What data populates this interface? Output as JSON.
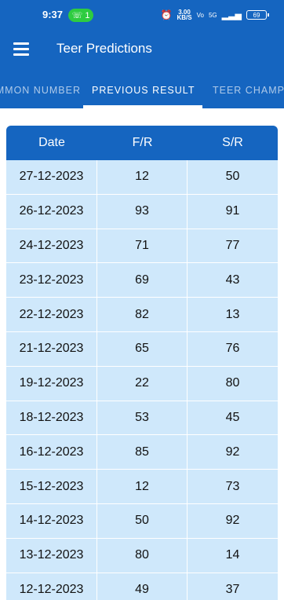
{
  "status_bar": {
    "time": "9:37",
    "call_count": "1",
    "speed_value": "3.00",
    "speed_unit": "KB/S",
    "network": "5G",
    "battery": "69"
  },
  "app_bar": {
    "title": "Teer Predictions"
  },
  "tabs": [
    {
      "label": "COMMON NUMBER"
    },
    {
      "label": "PREVIOUS RESULT"
    },
    {
      "label": "TEER CHAMPION"
    }
  ],
  "table": {
    "headers": [
      "Date",
      "F/R",
      "S/R"
    ],
    "rows": [
      [
        "27-12-2023",
        "12",
        "50"
      ],
      [
        "26-12-2023",
        "93",
        "91"
      ],
      [
        "24-12-2023",
        "71",
        "77"
      ],
      [
        "23-12-2023",
        "69",
        "43"
      ],
      [
        "22-12-2023",
        "82",
        "13"
      ],
      [
        "21-12-2023",
        "65",
        "76"
      ],
      [
        "19-12-2023",
        "22",
        "80"
      ],
      [
        "18-12-2023",
        "53",
        "45"
      ],
      [
        "16-12-2023",
        "85",
        "92"
      ],
      [
        "15-12-2023",
        "12",
        "73"
      ],
      [
        "14-12-2023",
        "50",
        "92"
      ],
      [
        "13-12-2023",
        "80",
        "14"
      ],
      [
        "12-12-2023",
        "49",
        "37"
      ]
    ]
  }
}
